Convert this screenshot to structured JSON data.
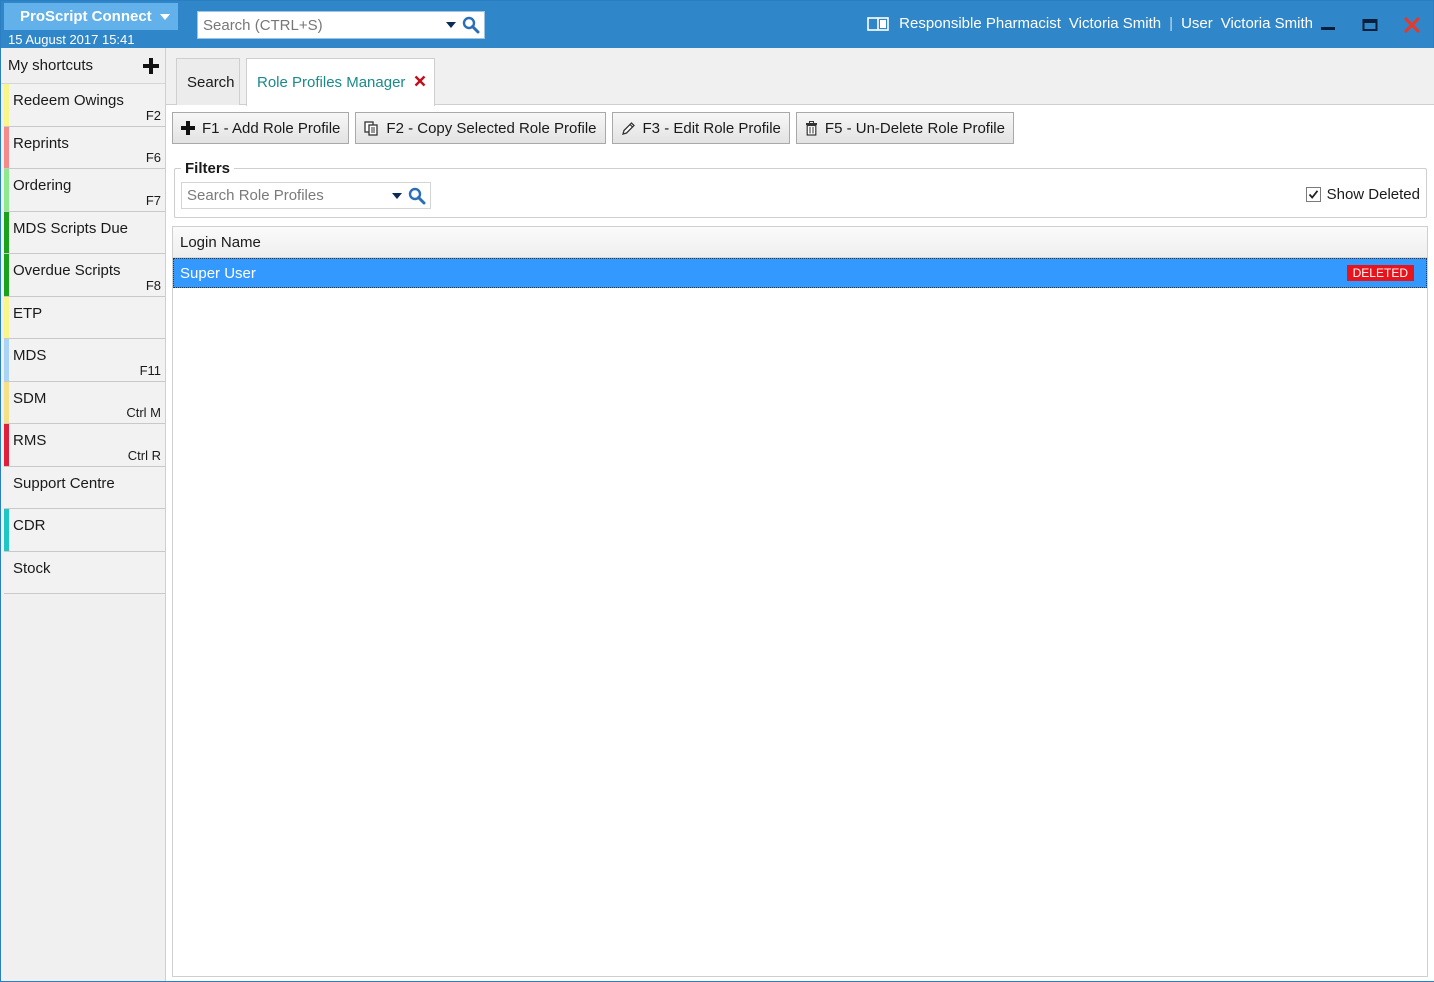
{
  "titlebar": {
    "app_name": "ProScript Connect",
    "datetime": "15 August 2017 15:41",
    "search_placeholder": "Search (CTRL+S)",
    "pharmacist_label": "Responsible Pharmacist",
    "pharmacist_name": "Victoria Smith",
    "user_label": "User",
    "user_name": "Victoria Smith",
    "separator": "|"
  },
  "sidebar": {
    "header": "My shortcuts",
    "items": [
      {
        "label": "Redeem Owings",
        "key": "F2",
        "color": "#f6f68a"
      },
      {
        "label": "Reprints",
        "key": "F6",
        "color": "#f48a8a"
      },
      {
        "label": "Ordering",
        "key": "F7",
        "color": "#8ee88e"
      },
      {
        "label": "MDS Scripts Due",
        "key": "",
        "color": "#1aa31a"
      },
      {
        "label": "Overdue Scripts",
        "key": "F8",
        "color": "#1aa31a"
      },
      {
        "label": "ETP",
        "key": "",
        "color": "#f6f68a"
      },
      {
        "label": "MDS",
        "key": "F11",
        "color": "#a9d4f5"
      },
      {
        "label": "SDM",
        "key": "Ctrl M",
        "color": "#f5e08a"
      },
      {
        "label": "RMS",
        "key": "Ctrl R",
        "color": "#e0203a"
      },
      {
        "label": "Support Centre",
        "key": "",
        "color": ""
      },
      {
        "label": "CDR",
        "key": "",
        "color": "#1fc6c6"
      },
      {
        "label": "Stock",
        "key": "",
        "color": ""
      }
    ]
  },
  "tabs": {
    "search": "Search",
    "active": "Role Profiles Manager"
  },
  "toolbar": {
    "add": "F1 - Add Role Profile",
    "copy": "F2 - Copy Selected Role Profile",
    "edit": "F3 - Edit Role Profile",
    "undelete": "F5 - Un-Delete Role Profile"
  },
  "filters": {
    "legend": "Filters",
    "search_placeholder": "Search Role Profiles",
    "show_deleted_label": "Show Deleted",
    "show_deleted_checked": true
  },
  "grid": {
    "columns": [
      "Login Name"
    ],
    "rows": [
      {
        "login_name": "Super User",
        "status": "DELETED",
        "selected": true
      }
    ]
  },
  "colors": {
    "titlebar": "#2f86c8",
    "selection": "#3399ff",
    "deleted_badge": "#e8141c",
    "active_tab_text": "#1a8a8a"
  }
}
